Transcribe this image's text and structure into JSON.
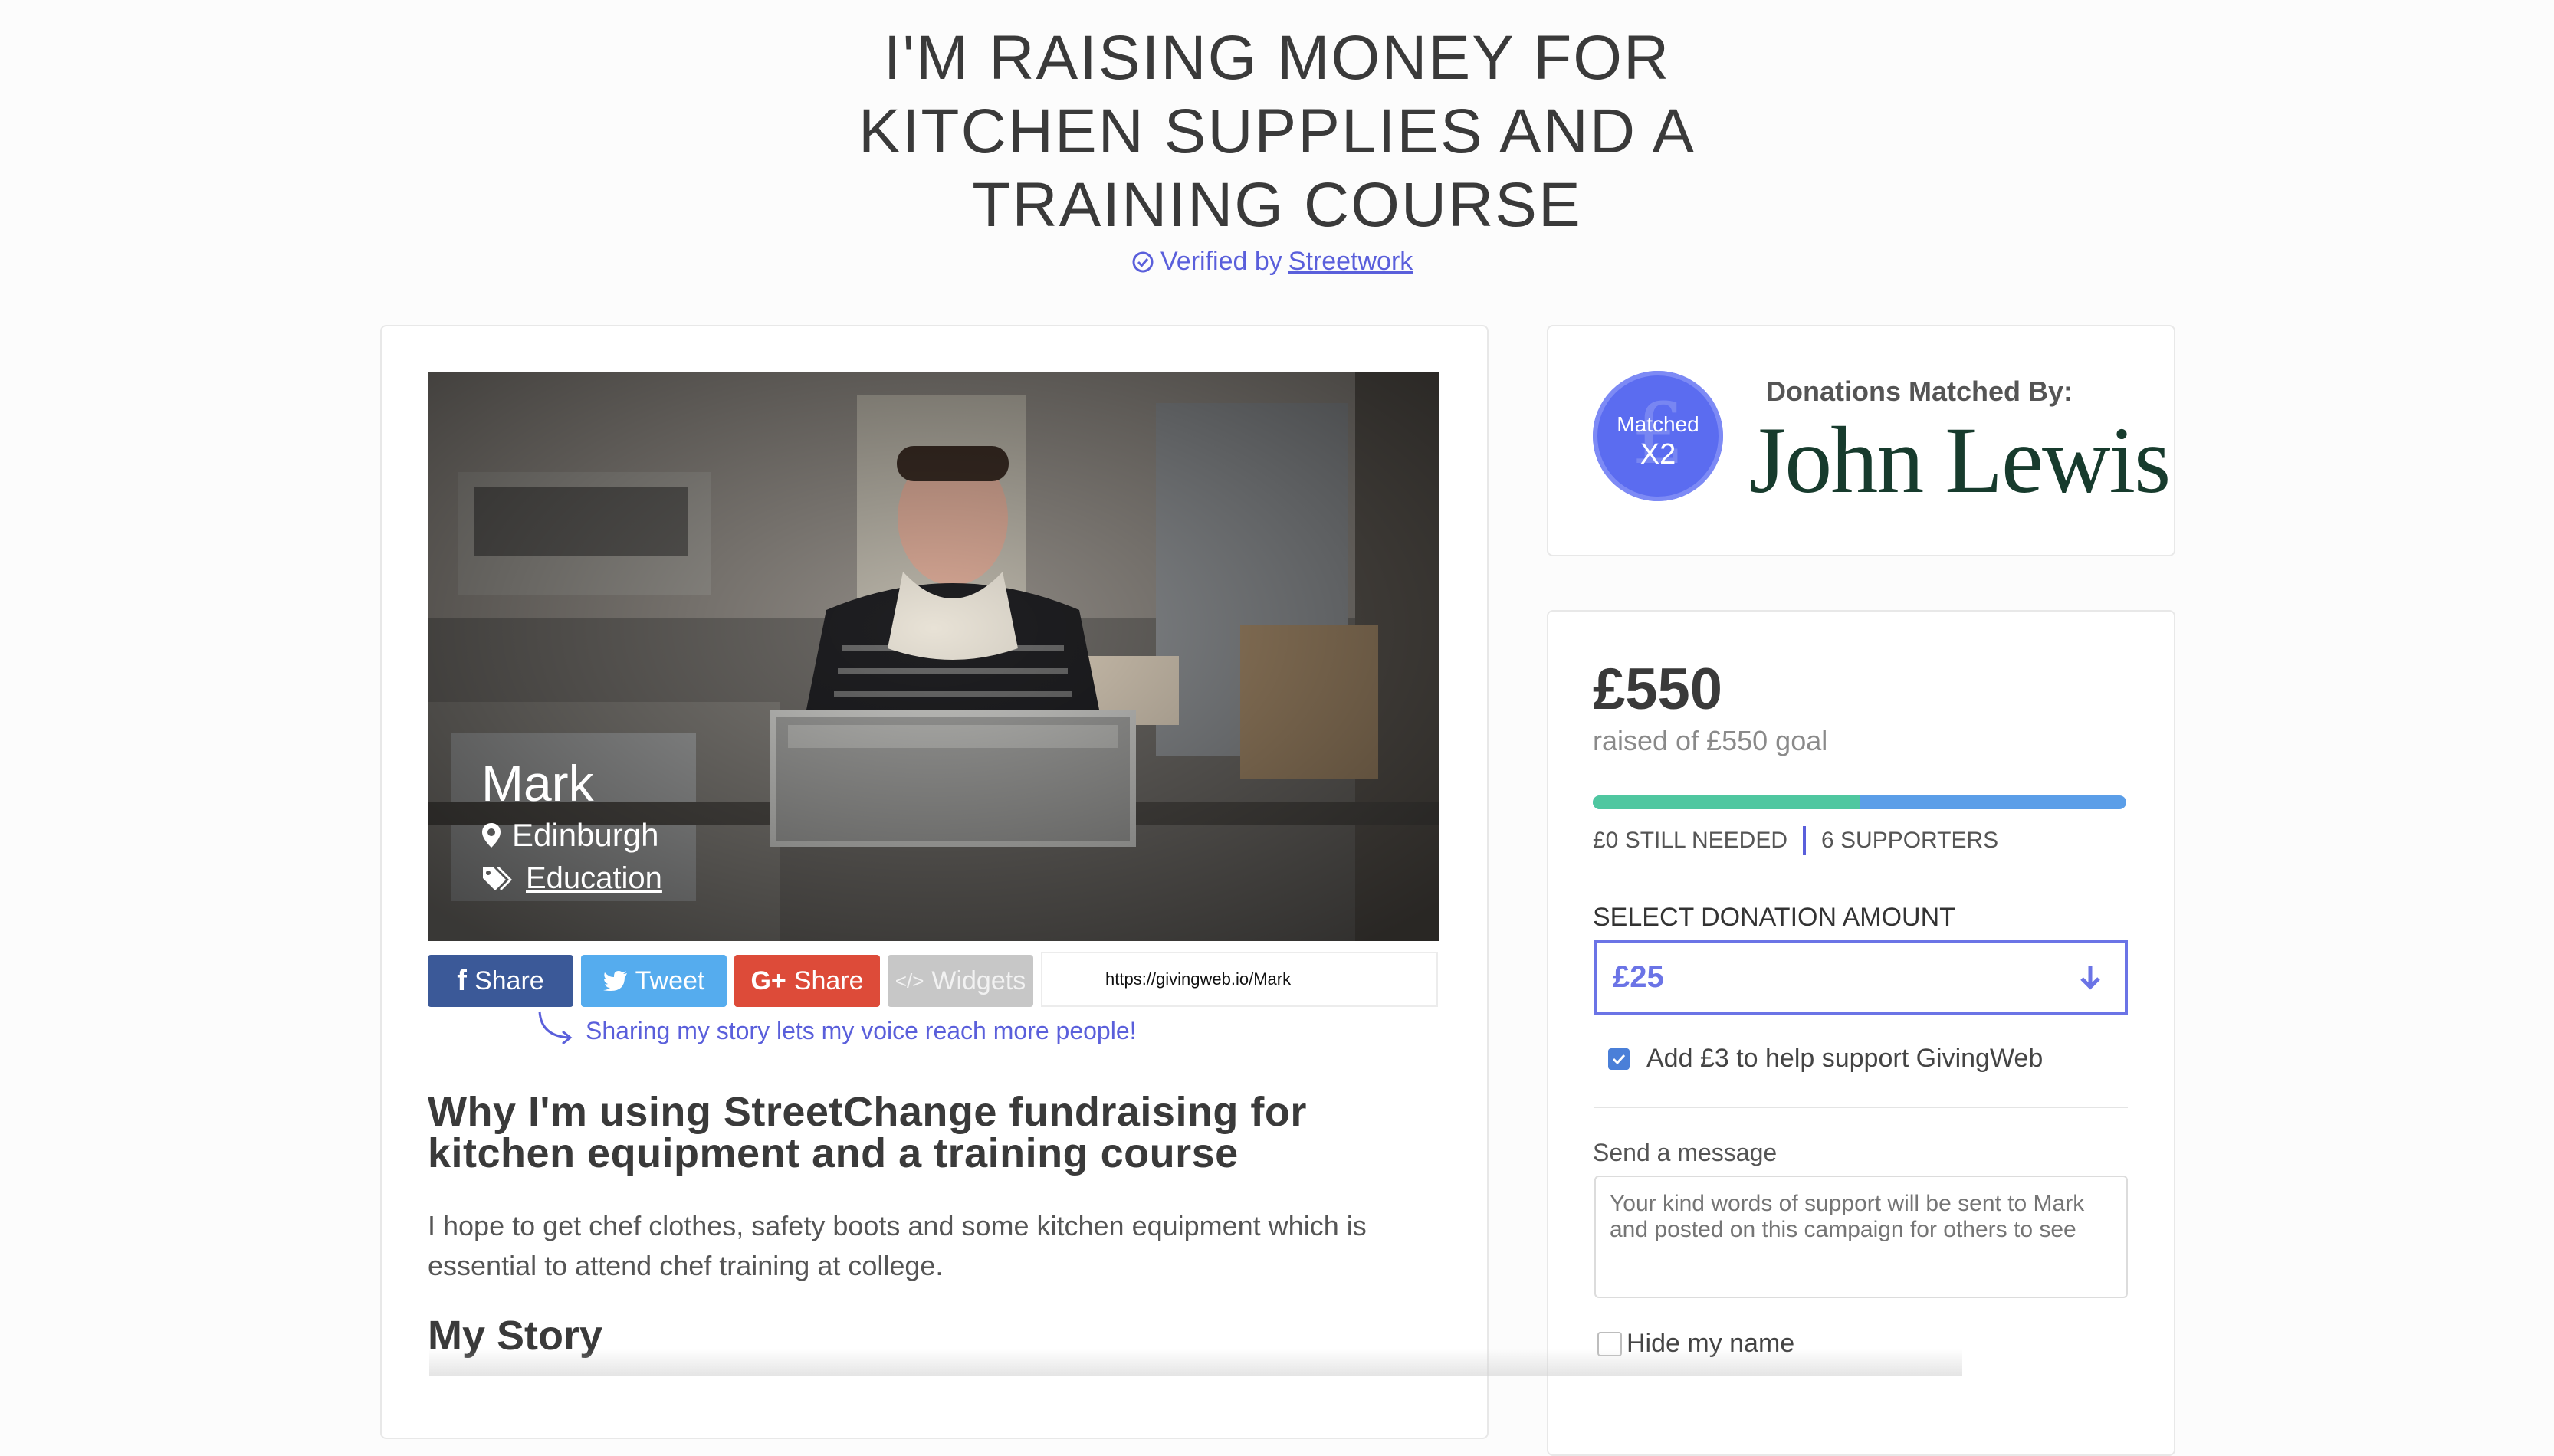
{
  "header": {
    "title": "I'M RAISING MONEY FOR KITCHEN SUPPLIES AND A TRAINING COURSE",
    "verified_prefix": "Verified by",
    "verified_by": "Streetwork"
  },
  "profile": {
    "name": "Mark",
    "location": "Edinburgh",
    "category": "Education"
  },
  "share": {
    "facebook_label": "Share",
    "twitter_label": "Tweet",
    "google_label": "Share",
    "widgets_label": "Widgets",
    "url": "https://givingweb.io/Mark",
    "note": "Sharing my story lets my voice reach more people!"
  },
  "content": {
    "why_heading": "Why I'm using StreetChange fundraising for kitchen equipment and a training course",
    "why_text": " I hope to get chef clothes, safety boots and some kitchen equipment which is essential to attend chef training at college.",
    "story_heading": "My Story"
  },
  "match": {
    "badge_label": "Matched",
    "badge_multiplier": "X2",
    "heading": "Donations Matched By:",
    "sponsor": "John Lewis"
  },
  "donation": {
    "raised": "£550",
    "goal_text": "raised of £550 goal",
    "progress_fraction": 1.0,
    "still_needed": "£0 STILL NEEDED",
    "supporters": "6 SUPPORTERS",
    "select_label": "SELECT DONATION AMOUNT",
    "selected_amount": "£25",
    "support_label": "Add £3 to help support GivingWeb",
    "support_checked": true,
    "message_label": "Send a message",
    "message_placeholder": "Your kind words of support will be sent to Mark and posted on this campaign for others to see",
    "hide_name_label": "Hide my name"
  },
  "colors": {
    "accent": "#5a5fdb",
    "progress_fill": "#4fc7a0",
    "progress_track": "#5b9ee8",
    "facebook": "#3b5998",
    "twitter": "#55acee",
    "google": "#dd4b39",
    "sponsor_green": "#173b2d"
  }
}
